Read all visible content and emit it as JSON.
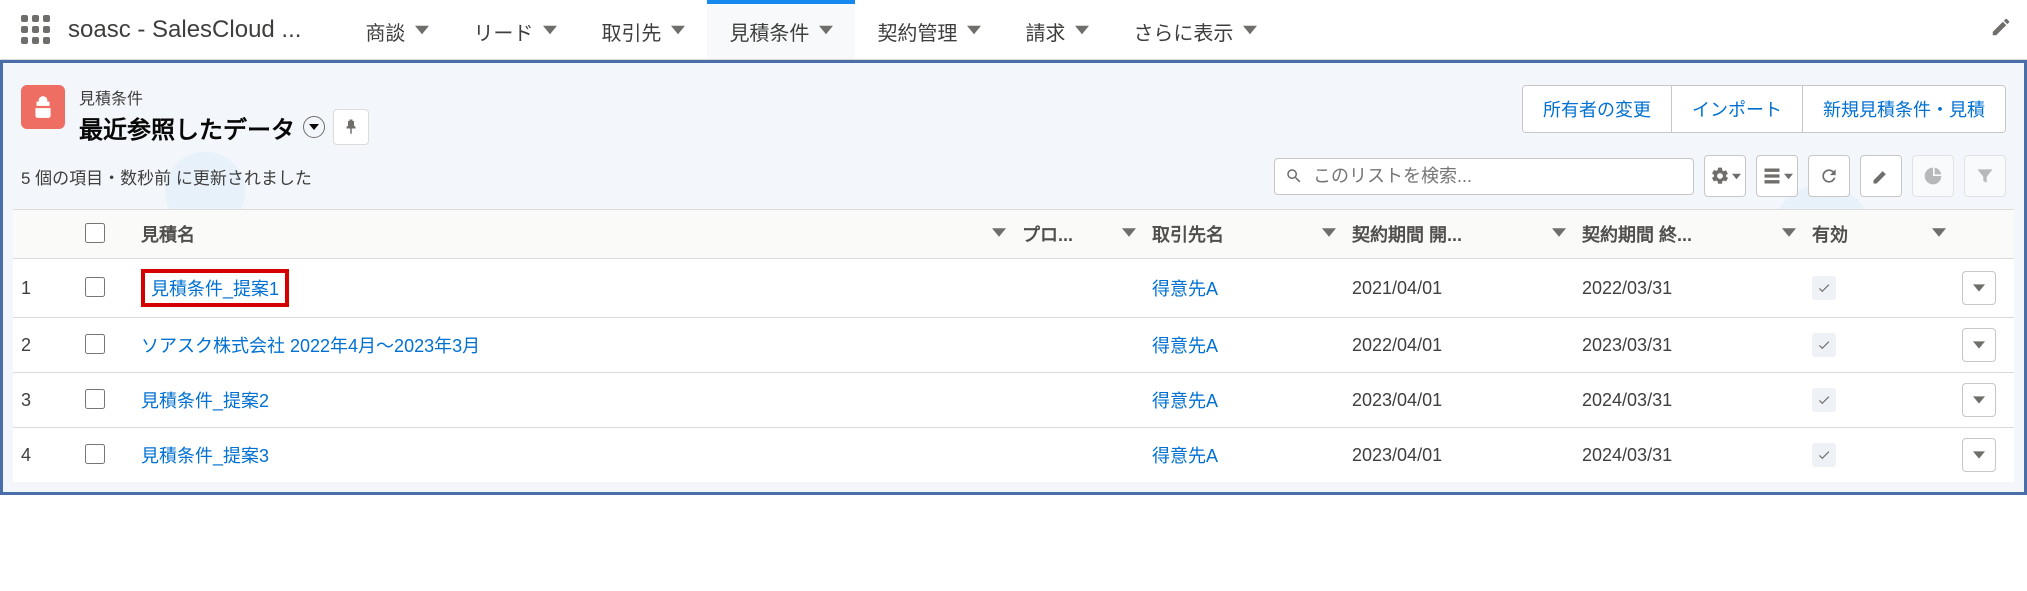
{
  "app": {
    "name": "soasc - SalesCloud ..."
  },
  "nav": {
    "items": [
      {
        "label": "商談"
      },
      {
        "label": "リード"
      },
      {
        "label": "取引先"
      },
      {
        "label": "見積条件",
        "active": true
      },
      {
        "label": "契約管理"
      },
      {
        "label": "請求"
      },
      {
        "label": "さらに表示"
      }
    ]
  },
  "header": {
    "object_label": "見積条件",
    "list_view_title": "最近参照したデータ",
    "actions": {
      "change_owner": "所有者の変更",
      "import": "インポート",
      "new": "新規見積条件・見積"
    }
  },
  "meta": {
    "text": "5 個の項目・数秒前 に更新されました",
    "search_placeholder": "このリストを検索..."
  },
  "columns": {
    "name": "見積名",
    "project": "プロ...",
    "account": "取引先名",
    "start": "契約期間 開...",
    "end": "契約期間 終...",
    "valid": "有効"
  },
  "rows": [
    {
      "num": "1",
      "name": "見積条件_提案1",
      "highlight": true,
      "account": "得意先A",
      "start": "2021/04/01",
      "end": "2022/03/31",
      "valid": true
    },
    {
      "num": "2",
      "name": "ソアスク株式会社 2022年4月～2023年3月",
      "account": "得意先A",
      "start": "2022/04/01",
      "end": "2023/03/31",
      "valid": true
    },
    {
      "num": "3",
      "name": "見積条件_提案2",
      "account": "得意先A",
      "start": "2023/04/01",
      "end": "2024/03/31",
      "valid": true
    },
    {
      "num": "4",
      "name": "見積条件_提案3",
      "account": "得意先A",
      "start": "2023/04/01",
      "end": "2024/03/31",
      "valid": true
    }
  ]
}
